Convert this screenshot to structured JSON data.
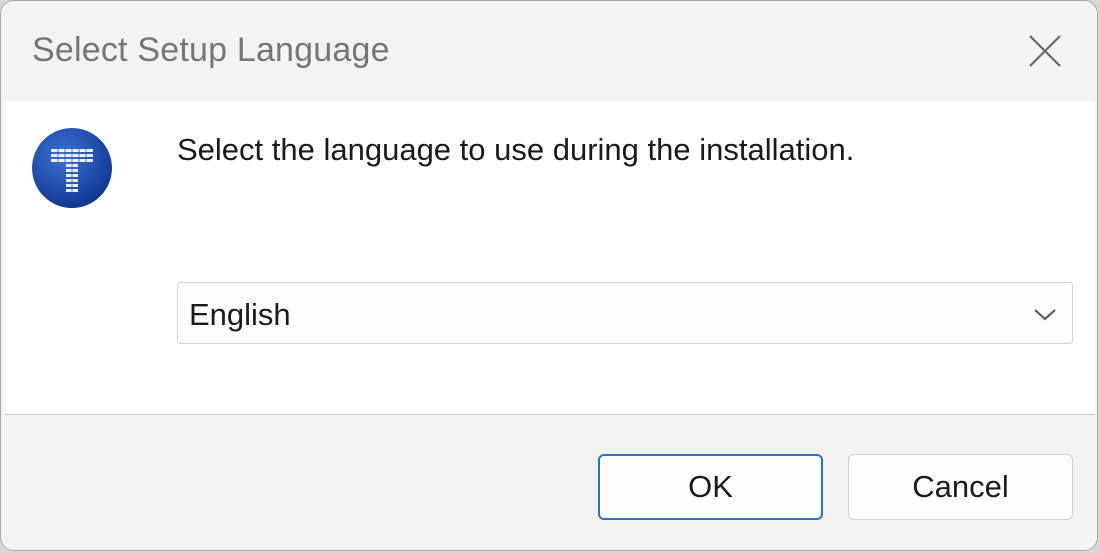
{
  "window": {
    "title": "Select Setup Language"
  },
  "content": {
    "prompt": "Select the language to use during the installation.",
    "language_select": {
      "value": "English"
    }
  },
  "footer": {
    "ok_label": "OK",
    "cancel_label": "Cancel"
  },
  "icons": {
    "app": "app-logo-icon",
    "close": "close-icon",
    "dropdown": "chevron-down-icon"
  },
  "colors": {
    "accent": "#2a74c6",
    "logo_blue": "#1f4fb5"
  }
}
